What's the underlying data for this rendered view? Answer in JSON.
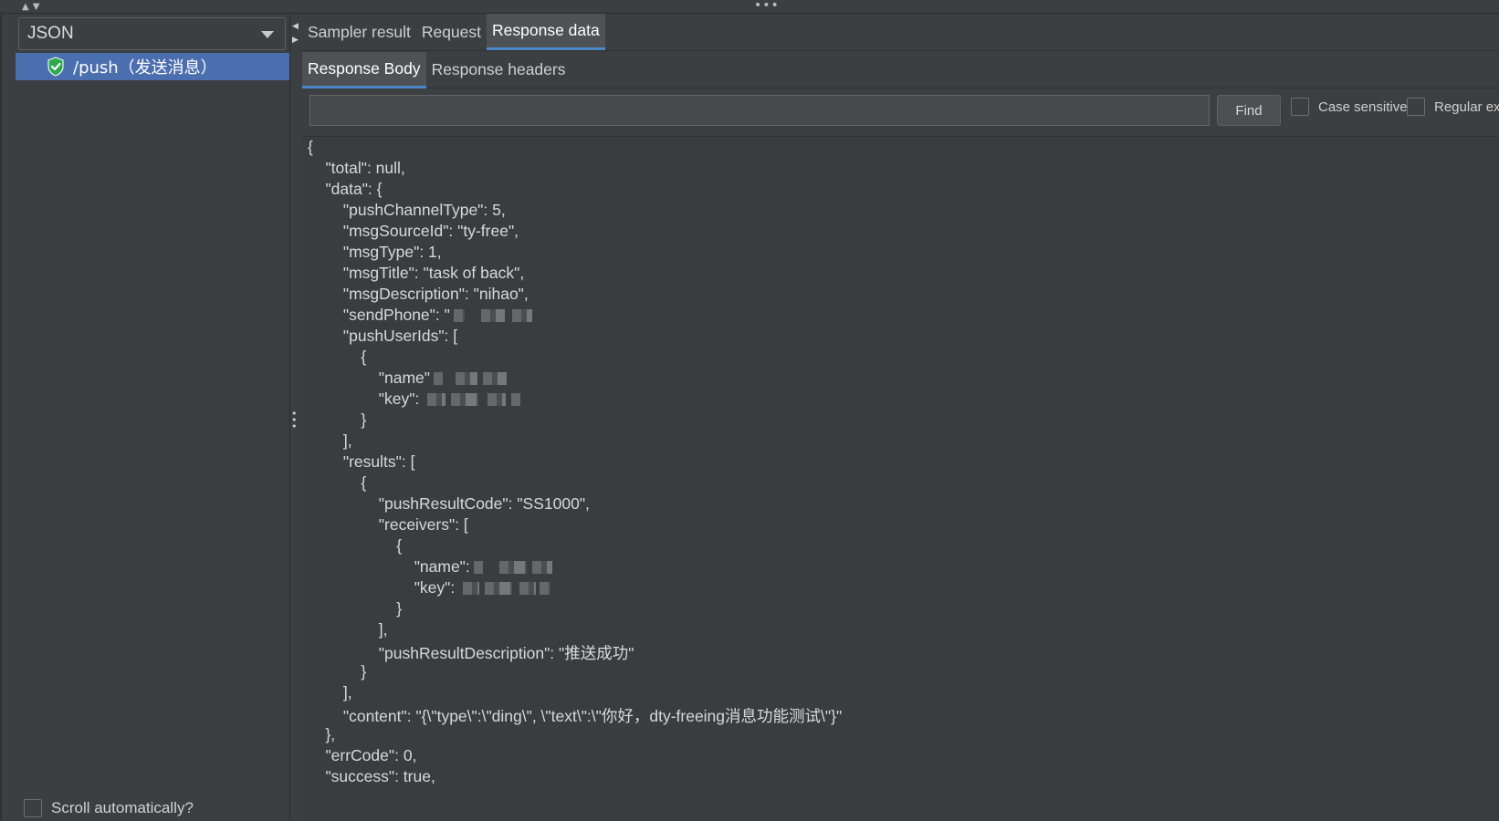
{
  "left_panel": {
    "renderer_select": "JSON",
    "tree_items": [
      {
        "label": "/push（发送消息）",
        "status": "success"
      }
    ],
    "scroll_label": "Scroll automatically?"
  },
  "tabs_main": [
    "Sampler result",
    "Request",
    "Response data"
  ],
  "tabs_sub": [
    "Response Body",
    "Response headers"
  ],
  "search": {
    "value": "",
    "find_label": "Find",
    "case_sensitive_label": "Case sensitive",
    "regex_label": "Regular ex"
  },
  "response_lines": [
    "{",
    "    \"total\": null,",
    "    \"data\": {",
    "        \"pushChannelType\": 5,",
    "        \"msgSourceId\": \"ty-free\",",
    "        \"msgType\": 1,",
    "        \"msgTitle\": \"task of back\",",
    "        \"msgDescription\": \"nihao\",",
    "        \"sendPhone\": \"",
    "        \"pushUserIds\": [",
    "            {",
    "                \"name\"",
    "                \"key\": ",
    "            }",
    "        ],",
    "        \"results\": [",
    "            {",
    "                \"pushResultCode\": \"SS1000\",",
    "                \"receivers\": [",
    "                    {",
    "                        \"name\":",
    "                        \"key\": ",
    "                    }",
    "                ],",
    "                \"pushResultDescription\": \"推送成功\"",
    "            }",
    "        ],",
    "        \"content\": \"{\\\"type\\\":\\\"ding\\\", \\\"text\\\":\\\"你好，dty-freeing消息功能测试\\\"}\"",
    "    },",
    "    \"errCode\": 0,",
    "    \"success\": true,"
  ],
  "colors": {
    "background": "#3c3f41",
    "selection": "#4b6eaf",
    "tab_active": "#4e5254",
    "tab_underline": "#4a88c7",
    "success_shield": "#2fa84f"
  }
}
